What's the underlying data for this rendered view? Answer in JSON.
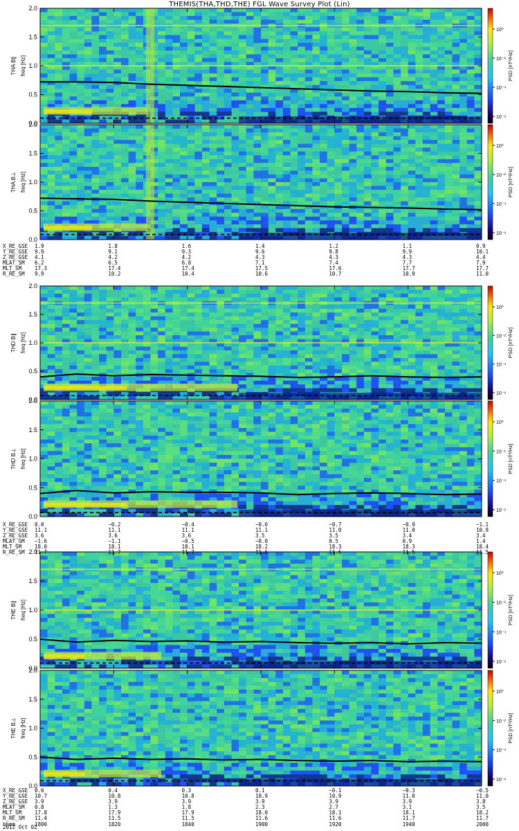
{
  "title": "THEMIS(THA,THD,THE) FGL Wave Survey Plot (Lin)",
  "colorbar": {
    "unit_label": "PSD [nT²/Hz]",
    "ticks": [
      "10⁰",
      "10⁻²",
      "10⁻⁴",
      "10⁻⁶"
    ]
  },
  "colors": {
    "background_spectrum": "#3fc7a0",
    "low_freq_band": "#1a3fe0",
    "quiet": "#0c1f8a",
    "enhanced": "#f2e60e",
    "trace": "#000000"
  },
  "chart_data": [
    {
      "type": "heatmap",
      "title": "THEMIS(THA,THD,THE) FGL Wave Survey Plot (Lin)",
      "panels": [
        {
          "probe": "THA",
          "component": "B∥",
          "ylabel": "THA B∥  freq [Hz]",
          "ylim": [
            0,
            2.0
          ],
          "yticks": [
            "0.0",
            "0.5",
            "1.0",
            "1.5",
            "2.0"
          ],
          "black_solid_line_hz": [
            0.72,
            0.72,
            0.71,
            0.68,
            0.66,
            0.64,
            0.62,
            0.6,
            0.58,
            0.56,
            0.55,
            0.53,
            0.52
          ],
          "black_dashed_line_hz": 0.09
        },
        {
          "probe": "THA",
          "component": "B⊥",
          "ylabel": "THA B⊥  freq [Hz]",
          "ylim": [
            0,
            2.0
          ],
          "yticks": [
            "0.0",
            "0.5",
            "1.0",
            "1.5",
            "2.0"
          ],
          "black_solid_line_hz": [
            0.72,
            0.71,
            0.7,
            0.67,
            0.65,
            0.63,
            0.61,
            0.59,
            0.57,
            0.56,
            0.55,
            0.53,
            0.52
          ],
          "black_dashed_line_hz": 0.09
        },
        {
          "probe": "THD",
          "component": "B∥",
          "ylabel": "THD B∥  freq [Hz]",
          "ylim": [
            0,
            2.0
          ],
          "yticks": [
            "0.0",
            "0.5",
            "1.0",
            "1.5",
            "2.0"
          ],
          "black_solid_line_hz": [
            0.4,
            0.45,
            0.42,
            0.44,
            0.43,
            0.42,
            0.41,
            0.39,
            0.4,
            0.42,
            0.4,
            0.39,
            0.4
          ],
          "black_dashed_line_hz": 0.07
        },
        {
          "probe": "THD",
          "component": "B⊥",
          "ylabel": "THD B⊥  freq [Hz]",
          "ylim": [
            0,
            2.0
          ],
          "yticks": [
            "0.0",
            "0.5",
            "1.0",
            "1.5",
            "2.0"
          ],
          "black_solid_line_hz": [
            0.4,
            0.45,
            0.41,
            0.43,
            0.42,
            0.42,
            0.41,
            0.38,
            0.4,
            0.41,
            0.4,
            0.38,
            0.39
          ],
          "black_dashed_line_hz": 0.07
        },
        {
          "probe": "THE",
          "component": "B∥",
          "ylabel": "THE B∥  freq [Hz]",
          "ylim": [
            0,
            2.0
          ],
          "yticks": [
            "0.0",
            "0.5",
            "1.0",
            "1.5",
            "2.0"
          ],
          "black_solid_line_hz": [
            0.5,
            0.45,
            0.48,
            0.46,
            0.47,
            0.45,
            0.46,
            0.44,
            0.43,
            0.44,
            0.42,
            0.44,
            0.43
          ],
          "black_dashed_line_hz": 0.09
        },
        {
          "probe": "THE",
          "component": "B⊥",
          "ylabel": "THE B⊥  freq [Hz]",
          "ylim": [
            0,
            2.0
          ],
          "yticks": [
            "0.0",
            "0.5",
            "1.0",
            "1.5",
            "2.0"
          ],
          "black_solid_line_hz": [
            0.5,
            0.46,
            0.48,
            0.46,
            0.47,
            0.45,
            0.46,
            0.44,
            0.43,
            0.44,
            0.42,
            0.43,
            0.42
          ],
          "black_dashed_line_hz": 0.09
        }
      ],
      "xlabel": "hhmm",
      "x": [
        "1800",
        "1820",
        "1840",
        "1900",
        "1920",
        "1940",
        "2000"
      ],
      "colorbar": {
        "label": "PSD [nT²/Hz]",
        "scale": "log",
        "ticks": [
          "10⁰",
          "10⁻²",
          "10⁻⁴",
          "10⁻⁶"
        ]
      }
    }
  ],
  "ephemeris": [
    {
      "probe": "THA",
      "rows": [
        {
          "label": "X_RE_GSE",
          "values": [
            "1.9",
            "1.8",
            "1.6",
            "1.4",
            "1.2",
            "1.1",
            "0.9"
          ]
        },
        {
          "label": "Y_RE_GSE",
          "values": [
            "9.9",
            "9.1",
            "9.3",
            "9.6",
            "9.8",
            "9.9",
            "10.1"
          ]
        },
        {
          "label": "Z_RE_GSE",
          "values": [
            "4.1",
            "4.2",
            "4.2",
            "4.3",
            "4.3",
            "4.3",
            "4.4"
          ]
        },
        {
          "label": "MLAT_SM",
          "values": [
            "6.2",
            "6.5",
            "6.8",
            "7.1",
            "7.4",
            "7.7",
            "7.9"
          ]
        },
        {
          "label": "MLT_SM",
          "values": [
            "17.3",
            "17.4",
            "17.4",
            "17.5",
            "17.6",
            "17.7",
            "17.7"
          ]
        },
        {
          "label": "R_RE_SM",
          "values": [
            "9.9",
            "10.2",
            "10.4",
            "10.6",
            "10.7",
            "10.9",
            "11.0"
          ]
        }
      ]
    },
    {
      "probe": "THD",
      "rows": [
        {
          "label": "X_RE_GSE",
          "values": [
            "0.0",
            "−0.2",
            "−0.4",
            "−0.6",
            "−0.7",
            "−0.9",
            "−1.1"
          ]
        },
        {
          "label": "Y_RE_GSE",
          "values": [
            "11.1",
            "11.1",
            "11.1",
            "11.1",
            "11.0",
            "11.0",
            "10.9"
          ]
        },
        {
          "label": "Z_RE_GSE",
          "values": [
            "3.6",
            "3.6",
            "3.6",
            "3.5",
            "3.5",
            "3.4",
            "3.4"
          ]
        },
        {
          "label": "MLAT_SM",
          "values": [
            "−1.6",
            "−1.1",
            "−0.5",
            "−0.0",
            "0.5",
            "0.9",
            "1.4"
          ]
        },
        {
          "label": "MLT_SM",
          "values": [
            "18.0",
            "18.1",
            "18.1",
            "18.2",
            "18.3",
            "18.3",
            "18.4"
          ]
        },
        {
          "label": "R_RE_SM",
          "values": [
            "11.7",
            "11.7",
            "11.7",
            "11.6",
            "11.6",
            "11.5",
            "11.5"
          ]
        }
      ]
    },
    {
      "probe": "THE",
      "rows": [
        {
          "label": "X_RE_GSE",
          "values": [
            "0.6",
            "0.4",
            "0.3",
            "0.1",
            "−0.1",
            "−0.3",
            "−0.5"
          ]
        },
        {
          "label": "Y_RE_GSE",
          "values": [
            "10.7",
            "10.8",
            "10.8",
            "10.9",
            "10.9",
            "11.0",
            "11.0"
          ]
        },
        {
          "label": "Z_RE_GSE",
          "values": [
            "3.9",
            "3.9",
            "3.9",
            "3.9",
            "3.9",
            "3.9",
            "3.8"
          ]
        },
        {
          "label": "MLAT_SM",
          "values": [
            "0.8",
            "1.3",
            "1.8",
            "2.3",
            "2.7",
            "3.1",
            "3.5"
          ]
        },
        {
          "label": "MLT_SM",
          "values": [
            "17.8",
            "17.9",
            "17.9",
            "18.0",
            "18.1",
            "18.1",
            "18.2"
          ]
        },
        {
          "label": "R_RE_SM",
          "values": [
            "11.4",
            "11.5",
            "11.5",
            "11.6",
            "11.6",
            "11.7",
            "11.7"
          ]
        },
        {
          "label": "hhmm",
          "values": [
            "1800",
            "1820",
            "1840",
            "1900",
            "1920",
            "1940",
            "2000"
          ]
        }
      ]
    }
  ],
  "date_label": "2012 Oct 02"
}
